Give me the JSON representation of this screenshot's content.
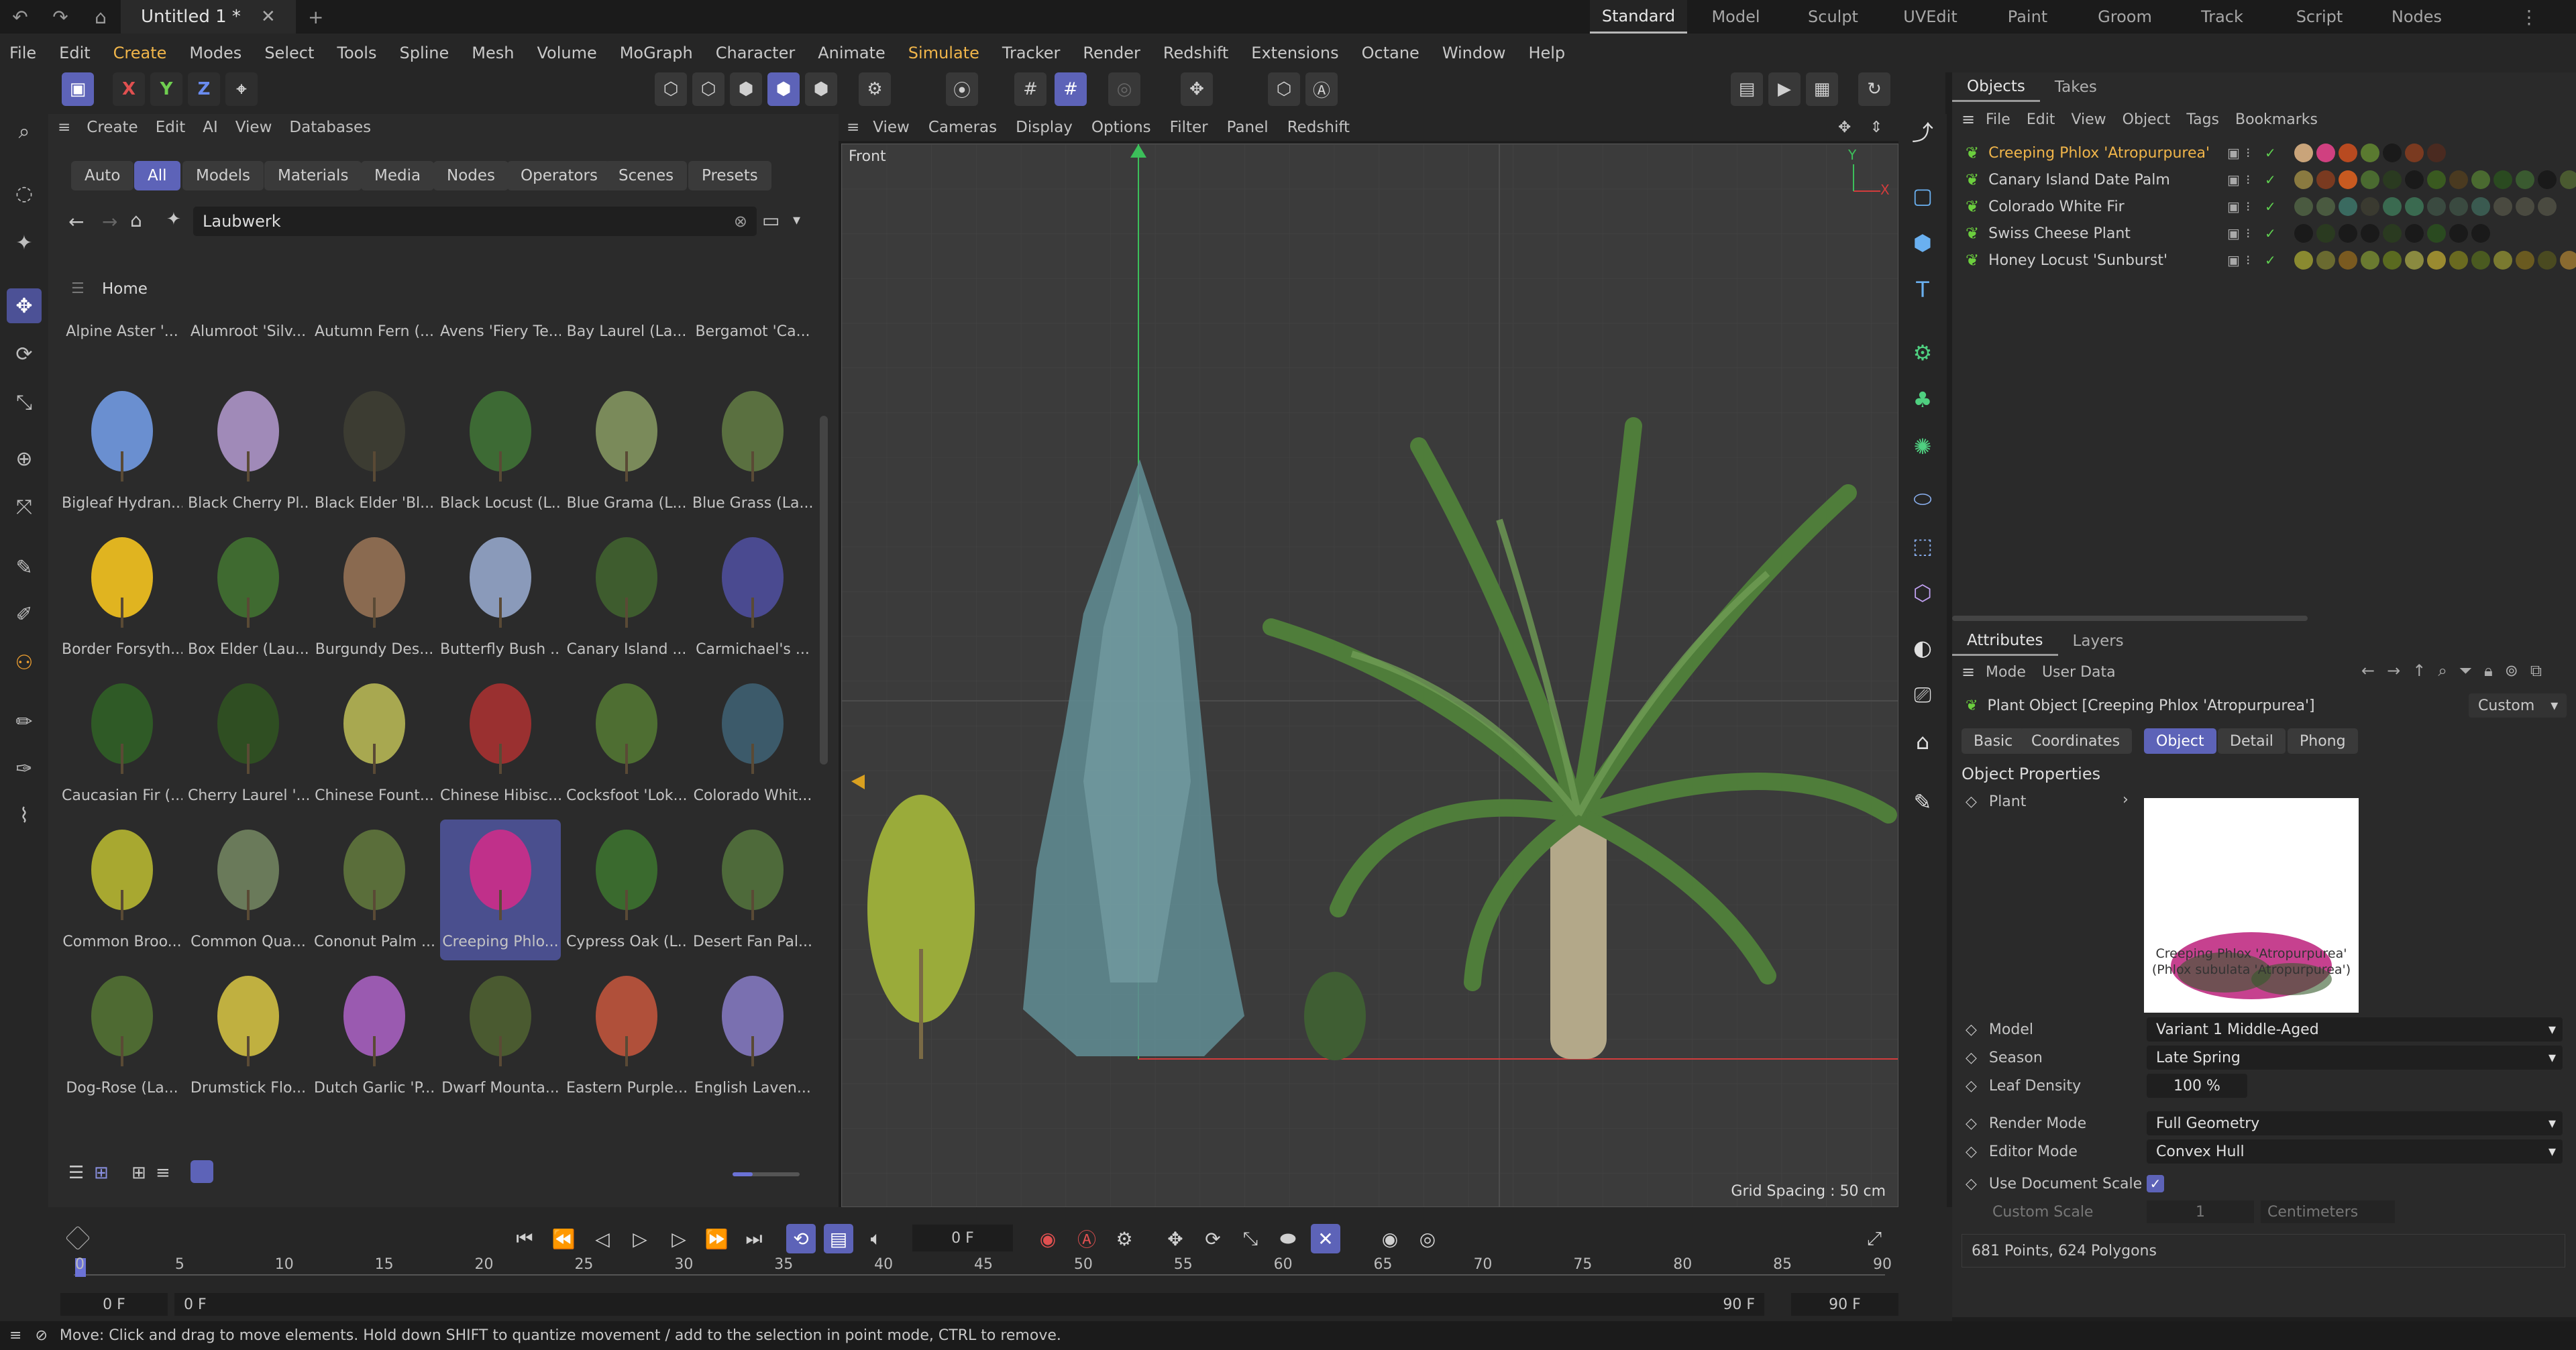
{
  "titlebar": {
    "doc_title": "Untitled 1 *",
    "layouts": [
      "Standard",
      "Model",
      "Sculpt",
      "UVEdit",
      "Paint",
      "Groom",
      "Track",
      "Script",
      "Nodes"
    ],
    "active_layout": "Standard"
  },
  "menubar": [
    "File",
    "Edit",
    "Create",
    "Modes",
    "Select",
    "Tools",
    "Spline",
    "Mesh",
    "Volume",
    "MoGraph",
    "Character",
    "Animate",
    "Simulate",
    "Tracker",
    "Render",
    "Redshift",
    "Extensions",
    "Octane",
    "Window",
    "Help"
  ],
  "axis": {
    "x": "X",
    "y": "Y",
    "z": "Z"
  },
  "asset_browser": {
    "menu": [
      "Create",
      "Edit",
      "AI",
      "View",
      "Databases"
    ],
    "filters": [
      "Auto",
      "All",
      "Models",
      "Materials",
      "Media",
      "Nodes",
      "Operators",
      "Scenes",
      "Presets"
    ],
    "active_filter": "All",
    "search_value": "Laubwerk",
    "breadcrumb": "Home",
    "top_row": [
      "Alpine Aster '...",
      "Alumroot 'Silv...",
      "Autumn Fern (...",
      "Avens 'Fiery Te...",
      "Bay Laurel (La...",
      "Bergamot 'Ca..."
    ],
    "rows": [
      [
        "Bigleaf Hydran...",
        "Black Cherry Pl...",
        "Black Elder 'Bl...",
        "Black Locust (L...",
        "Blue Grama (L...",
        "Blue Grass (La..."
      ],
      [
        "Border Forsyth...",
        "Box Elder (Lau...",
        "Burgundy Des...",
        "Butterfly Bush ...",
        "Canary Island ...",
        "Carmichael's ..."
      ],
      [
        "Caucasian Fir (...",
        "Cherry Laurel '...",
        "Chinese Fount...",
        "Chinese Hibisc...",
        "Cocksfoot 'Lok...",
        "Colorado Whit..."
      ],
      [
        "Common Broo...",
        "Common Qua...",
        "Cononut Palm ...",
        "Creeping Phlo...",
        "Cypress Oak (L...",
        "Desert Fan Pal..."
      ],
      [
        "Dog-Rose (La...",
        "Drumstick Flo...",
        "Dutch Garlic 'P...",
        "Dwarf Mounta...",
        "Eastern Purple...",
        "English Laven..."
      ]
    ],
    "selected": "Creeping Phlo..."
  },
  "viewport": {
    "menu": [
      "View",
      "Cameras",
      "Display",
      "Options",
      "Filter",
      "Panel",
      "Redshift"
    ],
    "label": "Front",
    "grid_info": "Grid Spacing : 50 cm"
  },
  "objects": {
    "tabs": [
      "Objects",
      "Takes"
    ],
    "menu": [
      "File",
      "Edit",
      "View",
      "Object",
      "Tags",
      "Bookmarks"
    ],
    "items": [
      "Creeping Phlox 'Atropurpurea'",
      "Canary Island Date Palm",
      "Colorado White Fir",
      "Swiss Cheese Plant",
      "Honey Locust 'Sunburst'"
    ]
  },
  "attributes": {
    "tabs": [
      "Attributes",
      "Layers"
    ],
    "menu": [
      "Mode",
      "User Data"
    ],
    "header": "Plant Object [Creeping Phlox 'Atropurpurea']",
    "custom": "Custom",
    "subtabs": [
      "Basic",
      "Coordinates",
      "Object",
      "Detail",
      "Phong"
    ],
    "active_subtab": "Object",
    "section": "Object Properties",
    "plant_label": "Plant",
    "preview_caption": "Creeping Phlox 'Atropurpurea' (Phlox subulata 'Atropurpurea')",
    "fields": [
      {
        "label": "Model",
        "value": "Variant 1 Middle-Aged"
      },
      {
        "label": "Season",
        "value": "Late Spring"
      },
      {
        "label": "Leaf Density",
        "value": "100 %"
      },
      {
        "label": "Render Mode",
        "value": "Full Geometry"
      },
      {
        "label": "Editor Mode",
        "value": "Convex Hull"
      }
    ],
    "use_doc_scale": "Use Document Scale",
    "custom_scale": "Custom Scale",
    "custom_scale_value": "1",
    "custom_scale_unit": "Centimeters",
    "stats": "681 Points, 624 Polygons"
  },
  "timeline": {
    "frame": "0 F",
    "ticks": [
      "0",
      "5",
      "10",
      "15",
      "20",
      "25",
      "30",
      "35",
      "40",
      "45",
      "50",
      "55",
      "60",
      "65",
      "70",
      "75",
      "80",
      "85",
      "90"
    ],
    "start": "0 F",
    "range_start": "0 F",
    "range_end": "90 F",
    "end": "90 F"
  },
  "status": "Move: Click and drag to move elements. Hold down SHIFT to quantize movement / add to the selection in point mode, CTRL to remove."
}
